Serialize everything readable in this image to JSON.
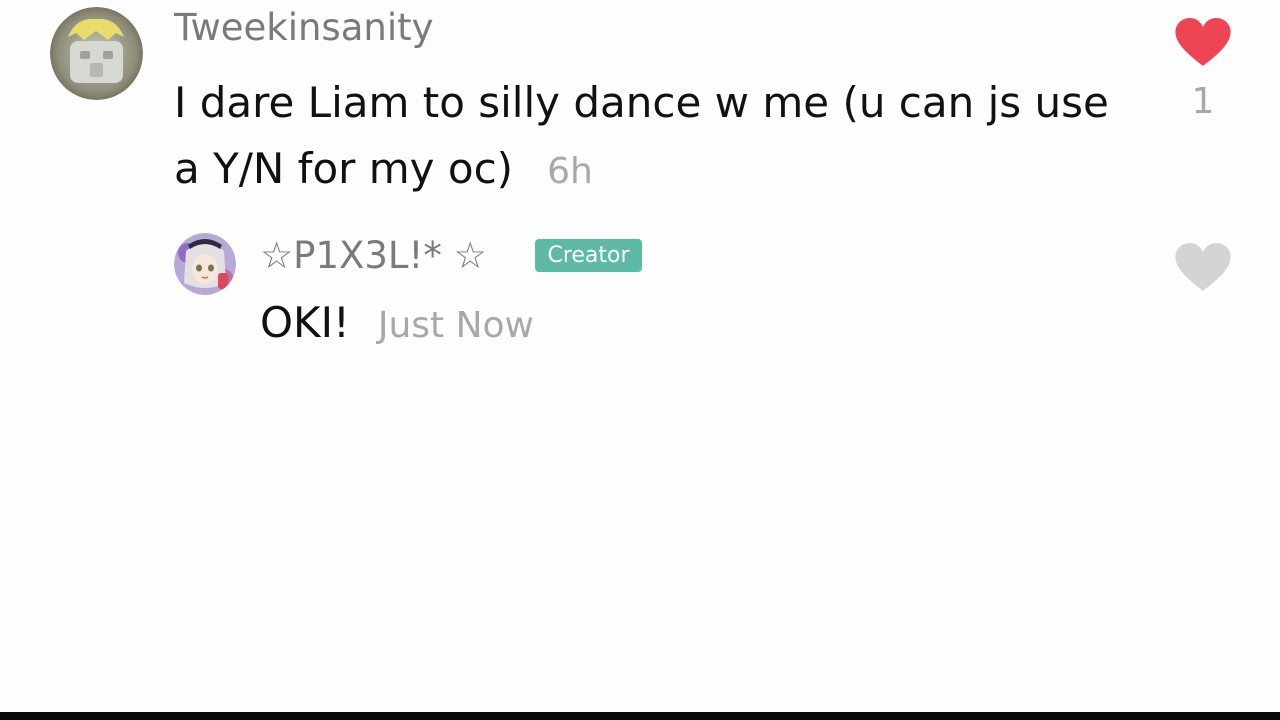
{
  "comments": [
    {
      "username": "Tweekinsanity",
      "text": "I dare Liam to silly dance w me (u can js use a Y/N for my oc)",
      "time": "6h",
      "likes": "1",
      "liked": true,
      "like_icon": "heart-icon",
      "like_color": "#ef4451"
    }
  ],
  "reply": {
    "username": "☆P1X3L!* ☆",
    "badge": "Creator",
    "badge_color": "#5cbaa7",
    "text": "OKI!",
    "time": "Just Now",
    "liked": false,
    "like_icon": "heart-outline-icon",
    "like_color": "#d4d4d4"
  }
}
